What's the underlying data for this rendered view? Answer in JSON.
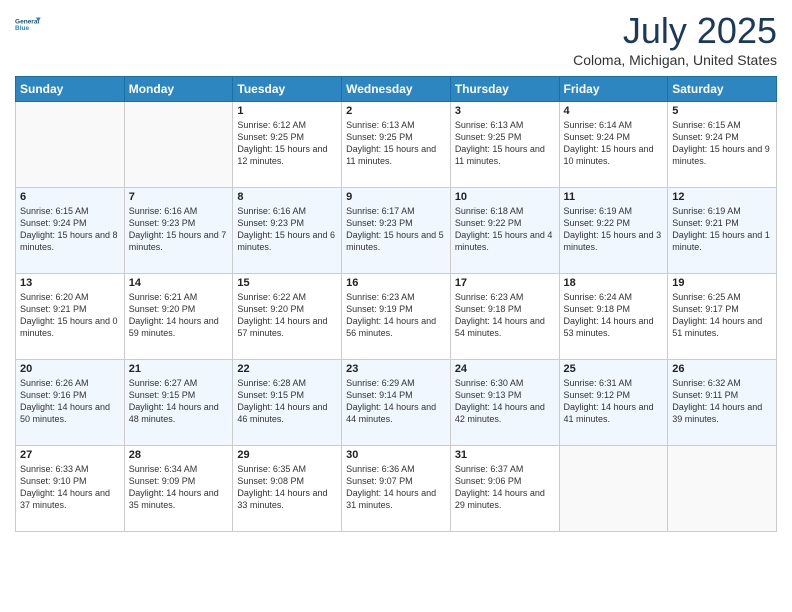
{
  "header": {
    "logo_line1": "General",
    "logo_line2": "Blue",
    "month": "July 2025",
    "location": "Coloma, Michigan, United States"
  },
  "weekdays": [
    "Sunday",
    "Monday",
    "Tuesday",
    "Wednesday",
    "Thursday",
    "Friday",
    "Saturday"
  ],
  "weeks": [
    [
      {
        "day": "",
        "sunrise": "",
        "sunset": "",
        "daylight": ""
      },
      {
        "day": "",
        "sunrise": "",
        "sunset": "",
        "daylight": ""
      },
      {
        "day": "1",
        "sunrise": "Sunrise: 6:12 AM",
        "sunset": "Sunset: 9:25 PM",
        "daylight": "Daylight: 15 hours and 12 minutes."
      },
      {
        "day": "2",
        "sunrise": "Sunrise: 6:13 AM",
        "sunset": "Sunset: 9:25 PM",
        "daylight": "Daylight: 15 hours and 11 minutes."
      },
      {
        "day": "3",
        "sunrise": "Sunrise: 6:13 AM",
        "sunset": "Sunset: 9:25 PM",
        "daylight": "Daylight: 15 hours and 11 minutes."
      },
      {
        "day": "4",
        "sunrise": "Sunrise: 6:14 AM",
        "sunset": "Sunset: 9:24 PM",
        "daylight": "Daylight: 15 hours and 10 minutes."
      },
      {
        "day": "5",
        "sunrise": "Sunrise: 6:15 AM",
        "sunset": "Sunset: 9:24 PM",
        "daylight": "Daylight: 15 hours and 9 minutes."
      }
    ],
    [
      {
        "day": "6",
        "sunrise": "Sunrise: 6:15 AM",
        "sunset": "Sunset: 9:24 PM",
        "daylight": "Daylight: 15 hours and 8 minutes."
      },
      {
        "day": "7",
        "sunrise": "Sunrise: 6:16 AM",
        "sunset": "Sunset: 9:23 PM",
        "daylight": "Daylight: 15 hours and 7 minutes."
      },
      {
        "day": "8",
        "sunrise": "Sunrise: 6:16 AM",
        "sunset": "Sunset: 9:23 PM",
        "daylight": "Daylight: 15 hours and 6 minutes."
      },
      {
        "day": "9",
        "sunrise": "Sunrise: 6:17 AM",
        "sunset": "Sunset: 9:23 PM",
        "daylight": "Daylight: 15 hours and 5 minutes."
      },
      {
        "day": "10",
        "sunrise": "Sunrise: 6:18 AM",
        "sunset": "Sunset: 9:22 PM",
        "daylight": "Daylight: 15 hours and 4 minutes."
      },
      {
        "day": "11",
        "sunrise": "Sunrise: 6:19 AM",
        "sunset": "Sunset: 9:22 PM",
        "daylight": "Daylight: 15 hours and 3 minutes."
      },
      {
        "day": "12",
        "sunrise": "Sunrise: 6:19 AM",
        "sunset": "Sunset: 9:21 PM",
        "daylight": "Daylight: 15 hours and 1 minute."
      }
    ],
    [
      {
        "day": "13",
        "sunrise": "Sunrise: 6:20 AM",
        "sunset": "Sunset: 9:21 PM",
        "daylight": "Daylight: 15 hours and 0 minutes."
      },
      {
        "day": "14",
        "sunrise": "Sunrise: 6:21 AM",
        "sunset": "Sunset: 9:20 PM",
        "daylight": "Daylight: 14 hours and 59 minutes."
      },
      {
        "day": "15",
        "sunrise": "Sunrise: 6:22 AM",
        "sunset": "Sunset: 9:20 PM",
        "daylight": "Daylight: 14 hours and 57 minutes."
      },
      {
        "day": "16",
        "sunrise": "Sunrise: 6:23 AM",
        "sunset": "Sunset: 9:19 PM",
        "daylight": "Daylight: 14 hours and 56 minutes."
      },
      {
        "day": "17",
        "sunrise": "Sunrise: 6:23 AM",
        "sunset": "Sunset: 9:18 PM",
        "daylight": "Daylight: 14 hours and 54 minutes."
      },
      {
        "day": "18",
        "sunrise": "Sunrise: 6:24 AM",
        "sunset": "Sunset: 9:18 PM",
        "daylight": "Daylight: 14 hours and 53 minutes."
      },
      {
        "day": "19",
        "sunrise": "Sunrise: 6:25 AM",
        "sunset": "Sunset: 9:17 PM",
        "daylight": "Daylight: 14 hours and 51 minutes."
      }
    ],
    [
      {
        "day": "20",
        "sunrise": "Sunrise: 6:26 AM",
        "sunset": "Sunset: 9:16 PM",
        "daylight": "Daylight: 14 hours and 50 minutes."
      },
      {
        "day": "21",
        "sunrise": "Sunrise: 6:27 AM",
        "sunset": "Sunset: 9:15 PM",
        "daylight": "Daylight: 14 hours and 48 minutes."
      },
      {
        "day": "22",
        "sunrise": "Sunrise: 6:28 AM",
        "sunset": "Sunset: 9:15 PM",
        "daylight": "Daylight: 14 hours and 46 minutes."
      },
      {
        "day": "23",
        "sunrise": "Sunrise: 6:29 AM",
        "sunset": "Sunset: 9:14 PM",
        "daylight": "Daylight: 14 hours and 44 minutes."
      },
      {
        "day": "24",
        "sunrise": "Sunrise: 6:30 AM",
        "sunset": "Sunset: 9:13 PM",
        "daylight": "Daylight: 14 hours and 42 minutes."
      },
      {
        "day": "25",
        "sunrise": "Sunrise: 6:31 AM",
        "sunset": "Sunset: 9:12 PM",
        "daylight": "Daylight: 14 hours and 41 minutes."
      },
      {
        "day": "26",
        "sunrise": "Sunrise: 6:32 AM",
        "sunset": "Sunset: 9:11 PM",
        "daylight": "Daylight: 14 hours and 39 minutes."
      }
    ],
    [
      {
        "day": "27",
        "sunrise": "Sunrise: 6:33 AM",
        "sunset": "Sunset: 9:10 PM",
        "daylight": "Daylight: 14 hours and 37 minutes."
      },
      {
        "day": "28",
        "sunrise": "Sunrise: 6:34 AM",
        "sunset": "Sunset: 9:09 PM",
        "daylight": "Daylight: 14 hours and 35 minutes."
      },
      {
        "day": "29",
        "sunrise": "Sunrise: 6:35 AM",
        "sunset": "Sunset: 9:08 PM",
        "daylight": "Daylight: 14 hours and 33 minutes."
      },
      {
        "day": "30",
        "sunrise": "Sunrise: 6:36 AM",
        "sunset": "Sunset: 9:07 PM",
        "daylight": "Daylight: 14 hours and 31 minutes."
      },
      {
        "day": "31",
        "sunrise": "Sunrise: 6:37 AM",
        "sunset": "Sunset: 9:06 PM",
        "daylight": "Daylight: 14 hours and 29 minutes."
      },
      {
        "day": "",
        "sunrise": "",
        "sunset": "",
        "daylight": ""
      },
      {
        "day": "",
        "sunrise": "",
        "sunset": "",
        "daylight": ""
      }
    ]
  ]
}
